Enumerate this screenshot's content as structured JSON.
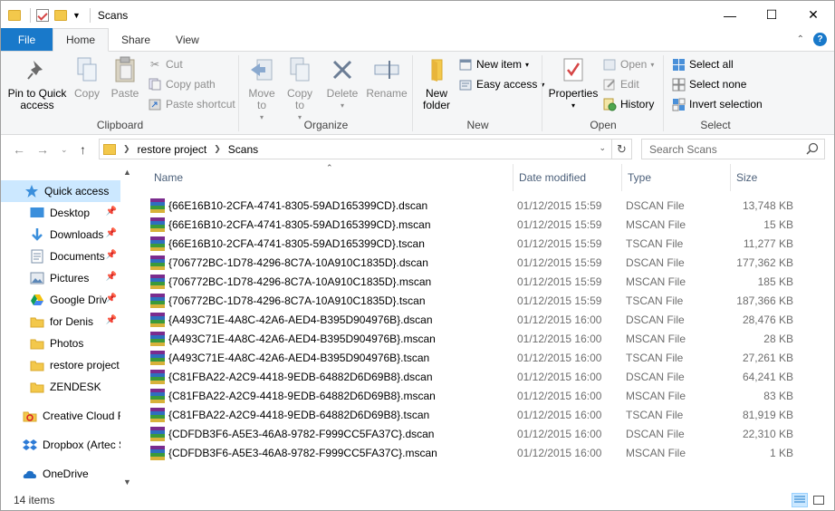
{
  "window": {
    "title": "Scans"
  },
  "tabs": [
    {
      "label": "File"
    },
    {
      "label": "Home"
    },
    {
      "label": "Share"
    },
    {
      "label": "View"
    }
  ],
  "ribbon": {
    "clipboard": {
      "label": "Clipboard",
      "pin": "Pin to Quick access",
      "copy": "Copy",
      "paste": "Paste",
      "cut": "Cut",
      "copy_path": "Copy path",
      "paste_shortcut": "Paste shortcut"
    },
    "organize": {
      "label": "Organize",
      "move_to": "Move to",
      "copy_to": "Copy to",
      "delete": "Delete",
      "rename": "Rename"
    },
    "new": {
      "label": "New",
      "new_folder": "New folder",
      "new_item": "New item",
      "easy_access": "Easy access"
    },
    "open": {
      "label": "Open",
      "properties": "Properties",
      "open": "Open",
      "edit": "Edit",
      "history": "History"
    },
    "select": {
      "label": "Select",
      "select_all": "Select all",
      "select_none": "Select none",
      "invert": "Invert selection"
    }
  },
  "address": {
    "crumbs": [
      "restore project",
      "Scans"
    ],
    "search_placeholder": "Search Scans"
  },
  "nav": [
    {
      "label": "Quick access",
      "icon": "star-icon",
      "pinned": false,
      "selected": true
    },
    {
      "label": "Desktop",
      "icon": "desktop-icon",
      "pinned": true
    },
    {
      "label": "Downloads",
      "icon": "downloads-icon",
      "pinned": true
    },
    {
      "label": "Documents",
      "icon": "documents-icon",
      "pinned": true
    },
    {
      "label": "Pictures",
      "icon": "pictures-icon",
      "pinned": true
    },
    {
      "label": "Google Driv",
      "icon": "google-drive-icon",
      "pinned": true
    },
    {
      "label": "for Denis",
      "icon": "folder-icon",
      "pinned": true
    },
    {
      "label": "Photos",
      "icon": "folder-icon",
      "pinned": false
    },
    {
      "label": "restore project",
      "icon": "folder-icon",
      "pinned": false
    },
    {
      "label": "ZENDESK",
      "icon": "folder-icon",
      "pinned": false
    },
    {
      "label": "Creative Cloud F",
      "icon": "creative-cloud-icon",
      "pinned": false
    },
    {
      "label": "Dropbox (Artec S",
      "icon": "dropbox-icon",
      "pinned": false
    },
    {
      "label": "OneDrive",
      "icon": "onedrive-icon",
      "pinned": false
    }
  ],
  "columns": {
    "name": "Name",
    "date": "Date modified",
    "type": "Type",
    "size": "Size"
  },
  "files": [
    {
      "name": "{66E16B10-2CFA-4741-8305-59AD165399CD}.dscan",
      "date": "01/12/2015 15:59",
      "type": "DSCAN File",
      "size": "13,748 KB"
    },
    {
      "name": "{66E16B10-2CFA-4741-8305-59AD165399CD}.mscan",
      "date": "01/12/2015 15:59",
      "type": "MSCAN File",
      "size": "15 KB"
    },
    {
      "name": "{66E16B10-2CFA-4741-8305-59AD165399CD}.tscan",
      "date": "01/12/2015 15:59",
      "type": "TSCAN File",
      "size": "11,277 KB"
    },
    {
      "name": "{706772BC-1D78-4296-8C7A-10A910C1835D}.dscan",
      "date": "01/12/2015 15:59",
      "type": "DSCAN File",
      "size": "177,362 KB"
    },
    {
      "name": "{706772BC-1D78-4296-8C7A-10A910C1835D}.mscan",
      "date": "01/12/2015 15:59",
      "type": "MSCAN File",
      "size": "185 KB"
    },
    {
      "name": "{706772BC-1D78-4296-8C7A-10A910C1835D}.tscan",
      "date": "01/12/2015 15:59",
      "type": "TSCAN File",
      "size": "187,366 KB"
    },
    {
      "name": "{A493C71E-4A8C-42A6-AED4-B395D904976B}.dscan",
      "date": "01/12/2015 16:00",
      "type": "DSCAN File",
      "size": "28,476 KB"
    },
    {
      "name": "{A493C71E-4A8C-42A6-AED4-B395D904976B}.mscan",
      "date": "01/12/2015 16:00",
      "type": "MSCAN File",
      "size": "28 KB"
    },
    {
      "name": "{A493C71E-4A8C-42A6-AED4-B395D904976B}.tscan",
      "date": "01/12/2015 16:00",
      "type": "TSCAN File",
      "size": "27,261 KB"
    },
    {
      "name": "{C81FBA22-A2C9-4418-9EDB-64882D6D69B8}.dscan",
      "date": "01/12/2015 16:00",
      "type": "DSCAN File",
      "size": "64,241 KB"
    },
    {
      "name": "{C81FBA22-A2C9-4418-9EDB-64882D6D69B8}.mscan",
      "date": "01/12/2015 16:00",
      "type": "MSCAN File",
      "size": "83 KB"
    },
    {
      "name": "{C81FBA22-A2C9-4418-9EDB-64882D6D69B8}.tscan",
      "date": "01/12/2015 16:00",
      "type": "TSCAN File",
      "size": "81,919 KB"
    },
    {
      "name": "{CDFDB3F6-A5E3-46A8-9782-F999CC5FA37C}.dscan",
      "date": "01/12/2015 16:00",
      "type": "DSCAN File",
      "size": "22,310 KB"
    },
    {
      "name": "{CDFDB3F6-A5E3-46A8-9782-F999CC5FA37C}.mscan",
      "date": "01/12/2015 16:00",
      "type": "MSCAN File",
      "size": "1 KB"
    }
  ],
  "status": {
    "count": "14 items"
  },
  "colors": {
    "file_tab": "#1979ca",
    "selection": "#cce8ff",
    "folder": "#f3c84b"
  }
}
